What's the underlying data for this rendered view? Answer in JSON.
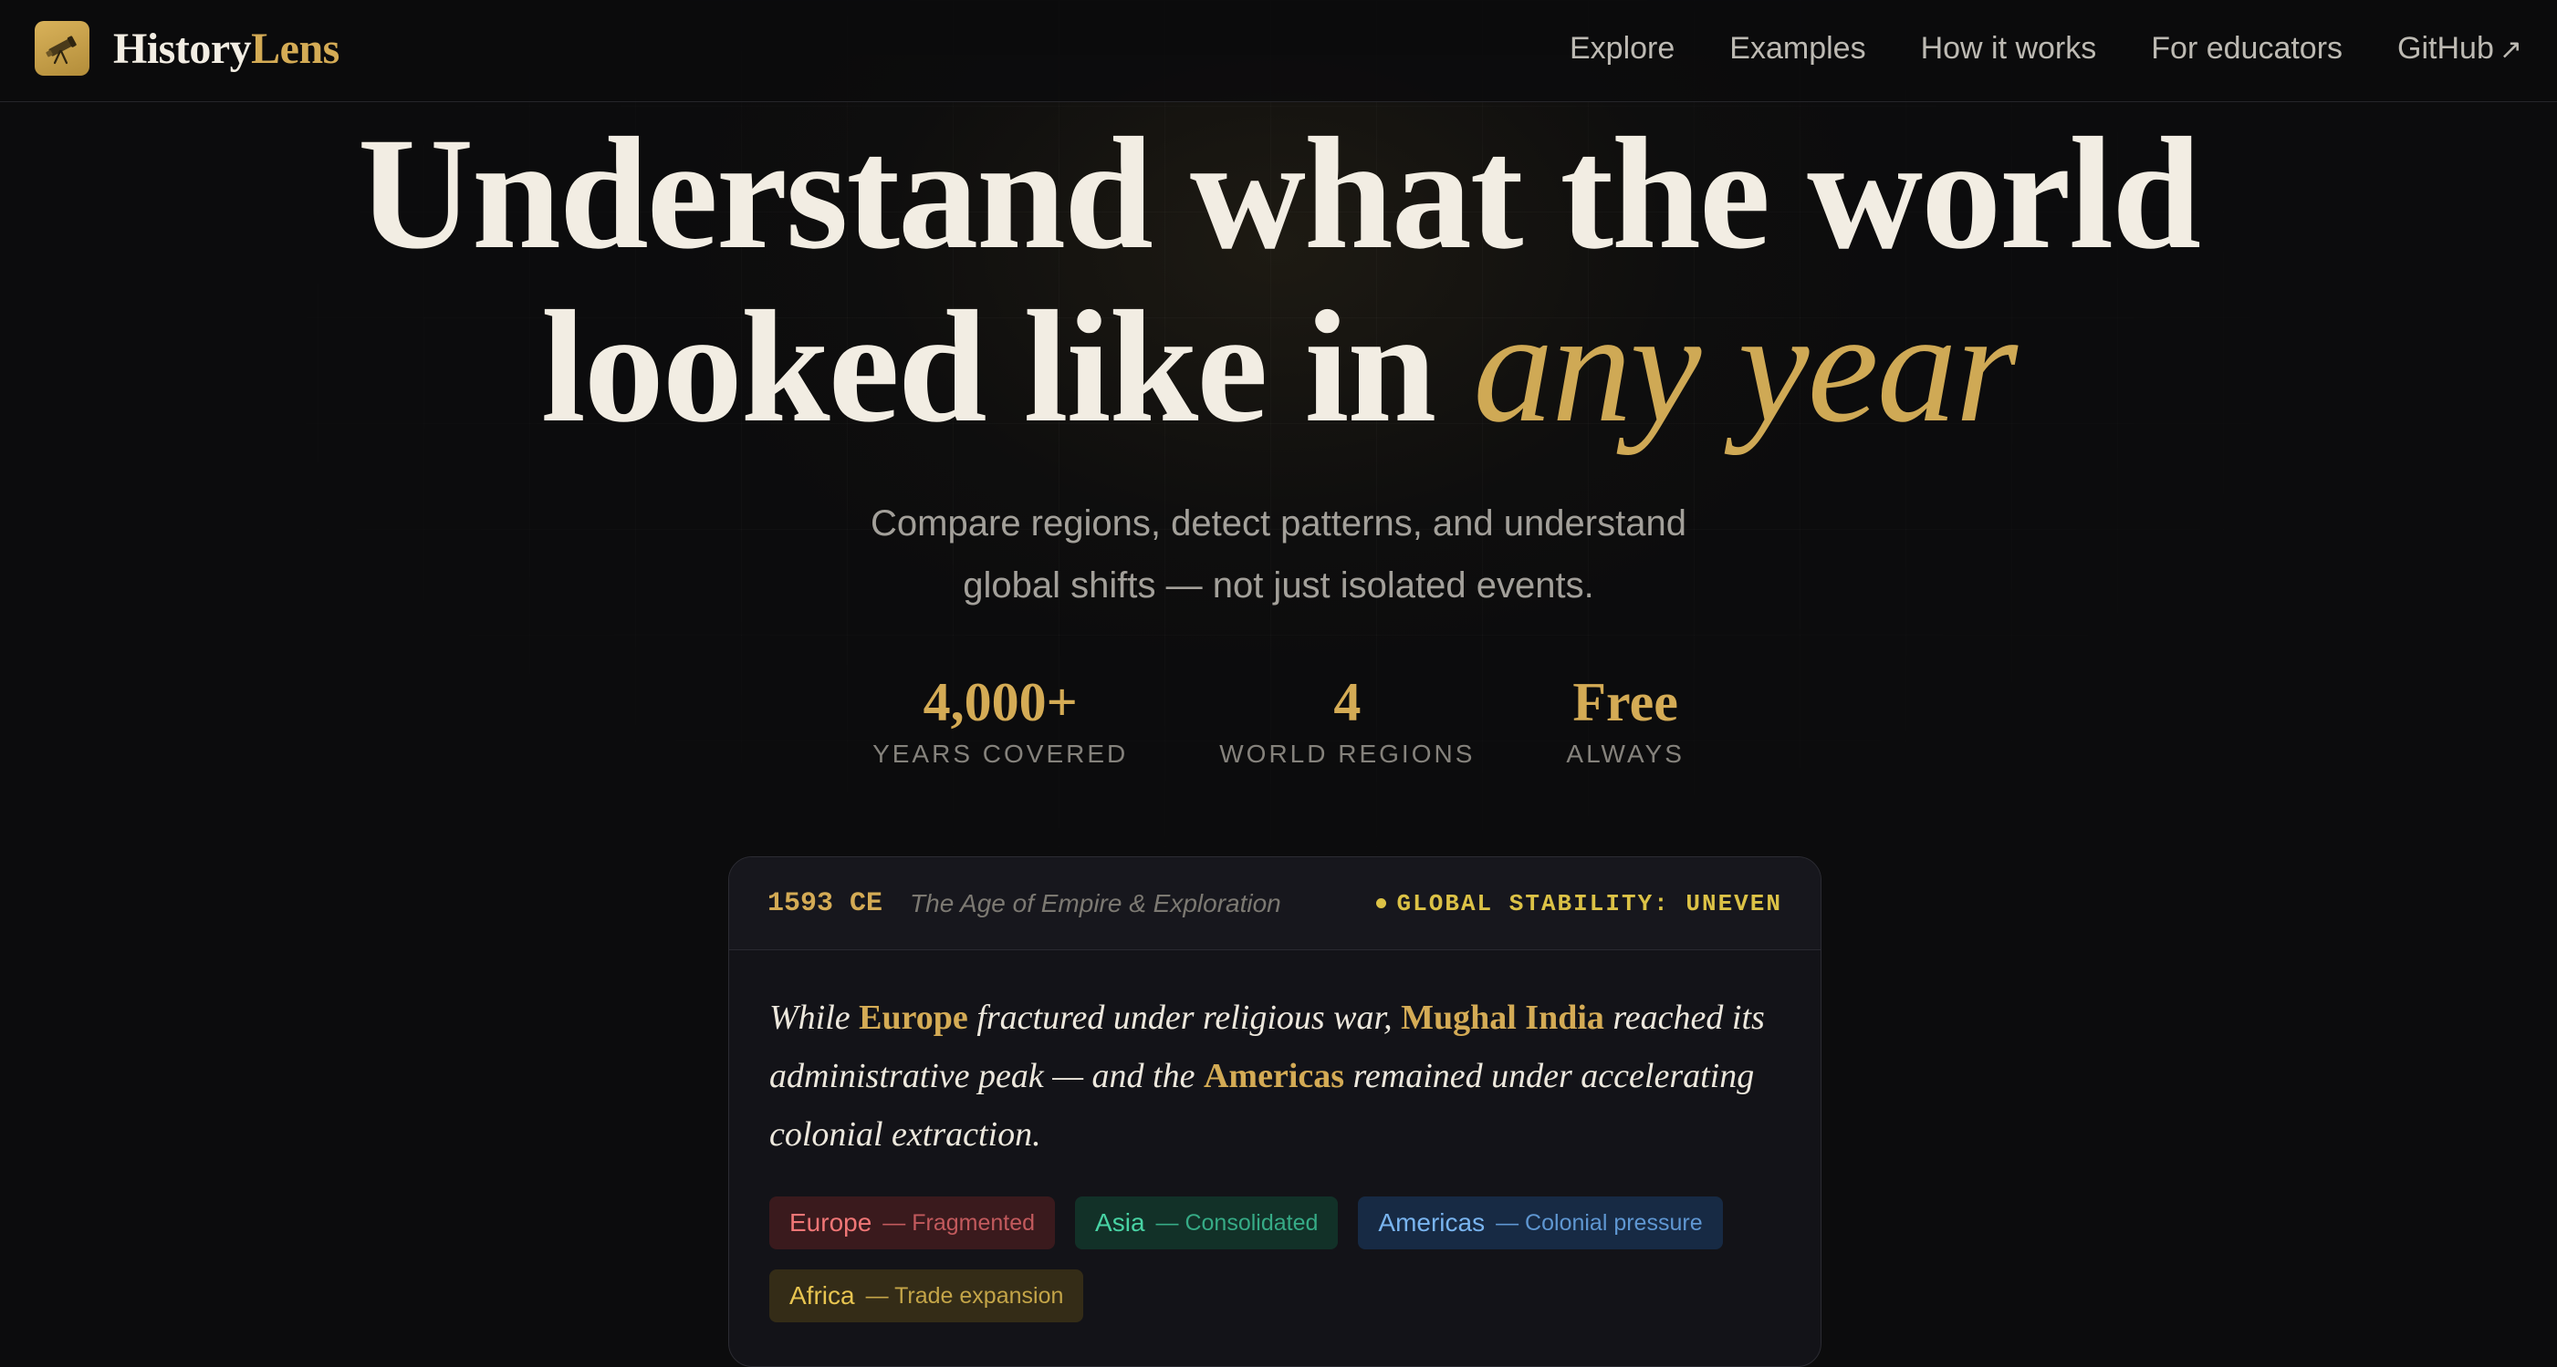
{
  "brand": {
    "name_part1": "History",
    "name_part2": "Lens",
    "logo_icon": "telescope-icon"
  },
  "nav": {
    "links": [
      "Explore",
      "Examples",
      "How it works",
      "For educators"
    ],
    "github": "GitHub",
    "github_arrow": "↗"
  },
  "hero": {
    "title_line1": "Understand what the world",
    "title_line2_start": "looked like in ",
    "title_line2_emphasis": "any year",
    "subtitle_line1": "Compare regions, detect patterns, and understand",
    "subtitle_line2": "global shifts — not just isolated events."
  },
  "stats": [
    {
      "value": "4,000+",
      "label": "YEARS COVERED"
    },
    {
      "value": "4",
      "label": "WORLD REGIONS"
    },
    {
      "value": "Free",
      "label": "ALWAYS"
    }
  ],
  "card": {
    "year": "1593 CE",
    "era": "The Age of Empire & Exploration",
    "status": "GLOBAL STABILITY: UNEVEN",
    "narrative": {
      "p1": "While ",
      "hl1": "Europe",
      "p2": " fractured under religious war, ",
      "hl2": "Mughal India",
      "p3": " reached its administrative peak — and the ",
      "hl3": "Americas",
      "p4": " remained under accelerating colonial extraction."
    },
    "tags": [
      {
        "region": "Europe",
        "desc": "— Fragmented",
        "color": "#ef7676"
      },
      {
        "region": "Asia",
        "desc": "— Consolidated",
        "color": "#48d3a4"
      },
      {
        "region": "Americas",
        "desc": "— Colonial pressure",
        "color": "#79b4ef"
      },
      {
        "region": "Africa",
        "desc": "— Trade expansion",
        "color": "#e7c450"
      }
    ]
  },
  "colors": {
    "accent_gold": "#d4ab55",
    "background": "#0c0c0d",
    "status_yellow": "#dcc246"
  }
}
